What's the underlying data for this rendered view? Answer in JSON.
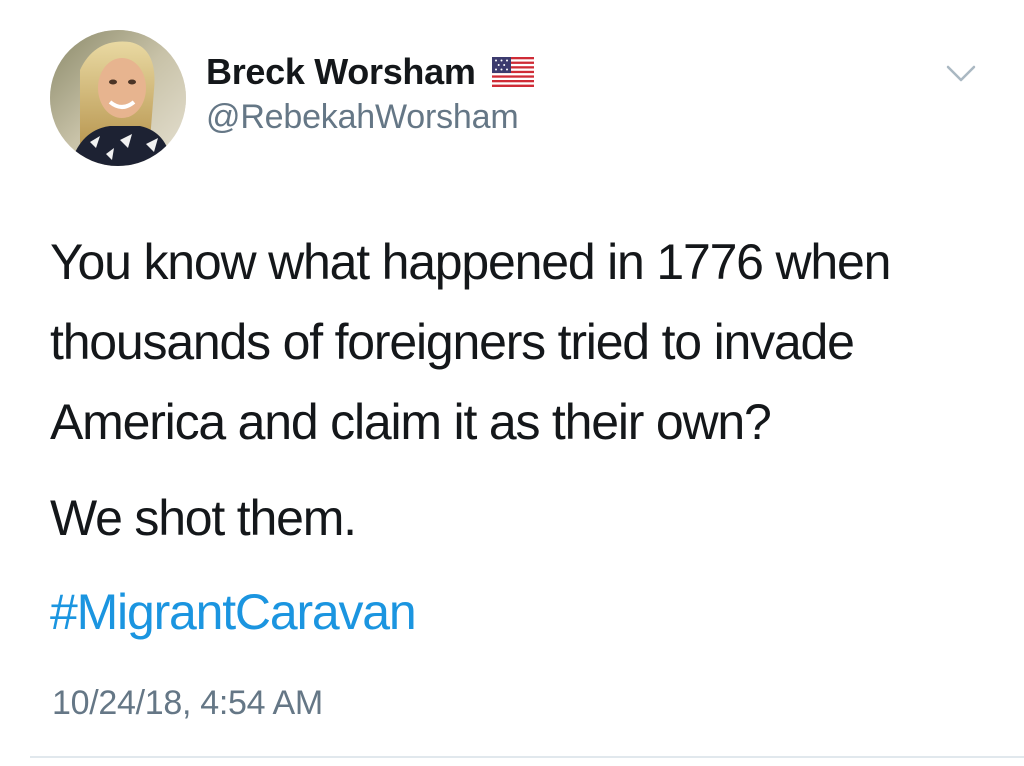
{
  "author": {
    "display_name": "Breck Worsham",
    "handle": "@RebekahWorsham",
    "avatar_icon": "profile-photo",
    "flag_icon": "us-flag-emoji"
  },
  "menu": {
    "icon": "chevron-down-icon"
  },
  "tweet": {
    "lines": [
      "You know what happened in 1776 when",
      "thousands of foreigners tried to invade",
      "America and claim it as their own?"
    ],
    "paragraph_2": "We shot them.",
    "hashtag": "#MigrantCaravan",
    "timestamp": "10/24/18, 4:54 AM"
  },
  "colors": {
    "text": "#14171a",
    "secondary": "#657786",
    "link": "#1b95e0",
    "divider": "#e1e8ed"
  }
}
